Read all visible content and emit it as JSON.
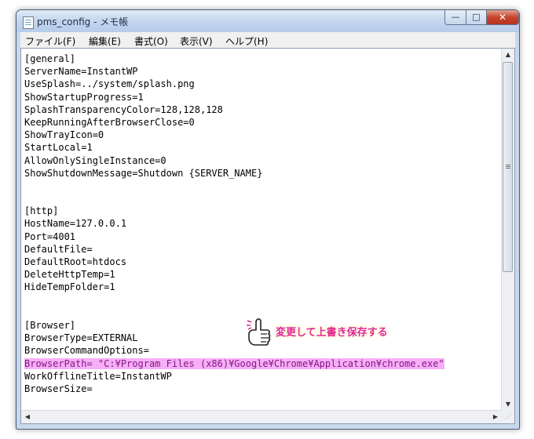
{
  "window": {
    "title": "pms_config - メモ帳",
    "controls": {
      "minimize": "—",
      "maximize": "□",
      "close": "✕"
    }
  },
  "menu": [
    "ファイル(F)",
    "編集(E)",
    "書式(O)",
    "表示(V)",
    "ヘルプ(H)"
  ],
  "lines": [
    "[general]",
    "ServerName=InstantWP",
    "UseSplash=../system/splash.png",
    "ShowStartupProgress=1",
    "SplashTransparencyColor=128,128,128",
    "KeepRunningAfterBrowserClose=0",
    "ShowTrayIcon=0",
    "StartLocal=1",
    "AllowOnlySingleInstance=0",
    "ShowShutdownMessage=Shutdown {SERVER_NAME}",
    "",
    "",
    "[http]",
    "HostName=127.0.0.1",
    "Port=4001",
    "DefaultFile=",
    "DefaultRoot=htdocs",
    "DeleteHttpTemp=1",
    "HideTempFolder=1",
    "",
    "",
    "[Browser]",
    "BrowserType=EXTERNAL",
    "BrowserCommandOptions=",
    "BrowserPath= \"C:¥Program Files (x86)¥Google¥Chrome¥Application¥chrome.exe\"",
    "WorkOfflineTitle=InstantWP",
    "BrowserSize="
  ],
  "highlighted_line": 24,
  "annotation": {
    "text": "変更して上書き保存する",
    "icon": "pointing-hand-icon"
  },
  "colors": {
    "highlight_bg": "#f5b0f5",
    "highlight_text": "#8a138a",
    "annotation_text": "#e0288a"
  },
  "scrollbar": {
    "up": "▲",
    "down": "▼",
    "left": "◀",
    "right": "▶"
  }
}
